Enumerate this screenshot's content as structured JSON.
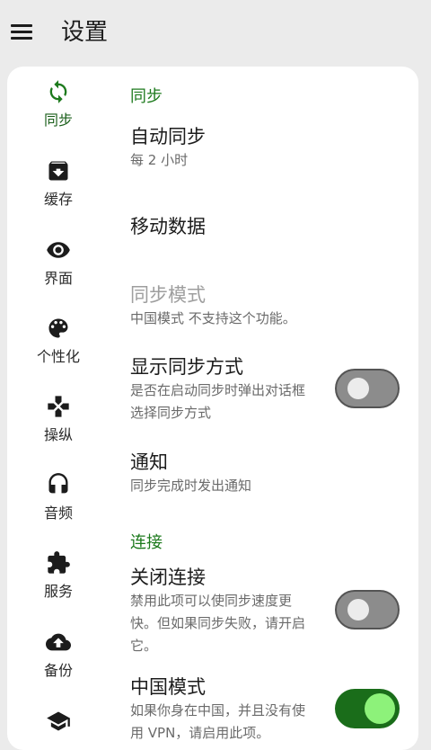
{
  "header": {
    "title": "设置",
    "menu_icon": "menu-icon"
  },
  "colors": {
    "accent": "#1d7a1d",
    "switch_on_track": "#1a6d1a",
    "switch_on_thumb": "#8df27a",
    "switch_off_track": "#8c8c8c"
  },
  "sidebar": {
    "items": [
      {
        "label": "同步",
        "icon": "sync-icon",
        "active": true
      },
      {
        "label": "缓存",
        "icon": "archive-icon"
      },
      {
        "label": "界面",
        "icon": "eye-icon"
      },
      {
        "label": "个性化",
        "icon": "palette-icon"
      },
      {
        "label": "操纵",
        "icon": "gamepad-icon"
      },
      {
        "label": "音频",
        "icon": "headphones-icon"
      },
      {
        "label": "服务",
        "icon": "extension-icon"
      },
      {
        "label": "备份",
        "icon": "cloud-upload-icon"
      },
      {
        "label": "",
        "icon": "school-icon"
      }
    ]
  },
  "main": {
    "sync_section": {
      "title": "同步",
      "auto_sync": {
        "title": "自动同步",
        "summary": "每 2 小时"
      },
      "mobile_data": {
        "title": "移动数据"
      },
      "sync_mode": {
        "title": "同步模式",
        "summary": "中国模式 不支持这个功能。",
        "enabled": false
      },
      "show_sync_method": {
        "title": "显示同步方式",
        "summary": "是否在启动同步时弹出对话框选择同步方式",
        "checked": false
      },
      "notification": {
        "title": "通知",
        "summary": "同步完成时发出通知"
      }
    },
    "connection_section": {
      "title": "连接",
      "close_connection": {
        "title": "关闭连接",
        "summary": "禁用此项可以使同步速度更快。但如果同步失败，请开启它。",
        "checked": false
      },
      "china_mode": {
        "title": "中国模式",
        "summary": "如果你身在中国，并且没有使用 VPN，请启用此项。",
        "checked": true
      }
    }
  }
}
